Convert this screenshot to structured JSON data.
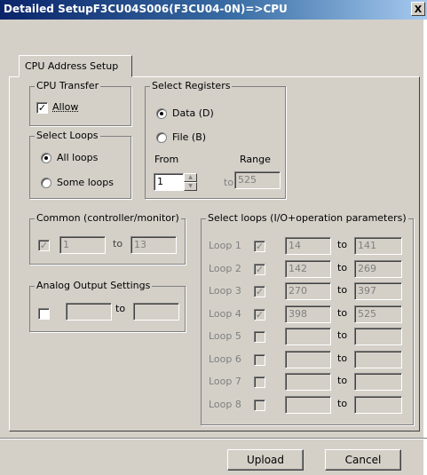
{
  "window": {
    "title": "Detailed SetupF3CU04S006(F3CU04-0N)=>CPU",
    "close_glyph": "X"
  },
  "tabs": [
    {
      "label": "CPU Address Setup"
    }
  ],
  "cpu_transfer": {
    "title": "CPU Transfer",
    "allow_label": "Allow",
    "allow_checked": true
  },
  "select_loops": {
    "title": "Select Loops",
    "all_label": "All loops",
    "some_label": "Some loops",
    "selected": "all"
  },
  "select_registers": {
    "title": "Select Registers",
    "data_label": "Data (D)",
    "file_label": "File (B)",
    "selected": "data",
    "from_label": "From",
    "range_label": "Range",
    "from_value": "1",
    "to_label": "to",
    "range_value": "525"
  },
  "common": {
    "title": "Common (controller/monitor)",
    "checked": true,
    "from": "1",
    "to_label": "to",
    "to": "13"
  },
  "analog": {
    "title": "Analog Output Settings",
    "checked": false,
    "from": "",
    "to_label": "to",
    "to": ""
  },
  "loops_group": {
    "title": "Select loops (I/O+operation parameters)",
    "to_label": "to",
    "rows": [
      {
        "label": "Loop 1",
        "checked": true,
        "from": "14",
        "to": "141"
      },
      {
        "label": "Loop 2",
        "checked": true,
        "from": "142",
        "to": "269"
      },
      {
        "label": "Loop 3",
        "checked": true,
        "from": "270",
        "to": "397"
      },
      {
        "label": "Loop 4",
        "checked": true,
        "from": "398",
        "to": "525"
      },
      {
        "label": "Loop 5",
        "checked": false,
        "from": "",
        "to": ""
      },
      {
        "label": "Loop 6",
        "checked": false,
        "from": "",
        "to": ""
      },
      {
        "label": "Loop 7",
        "checked": false,
        "from": "",
        "to": ""
      },
      {
        "label": "Loop 8",
        "checked": false,
        "from": "",
        "to": ""
      }
    ]
  },
  "buttons": {
    "upload": "Upload",
    "cancel": "Cancel"
  }
}
